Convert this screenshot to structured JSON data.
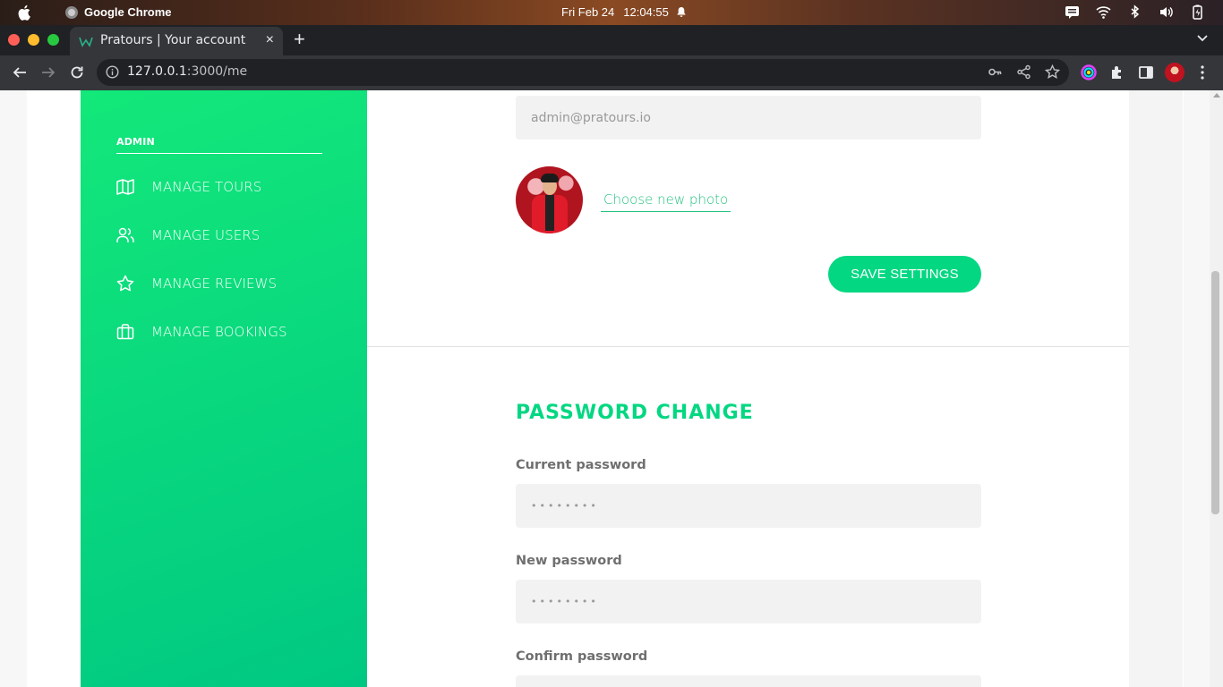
{
  "os": {
    "app_name": "Google Chrome",
    "date": "Fri Feb 24",
    "time": "12:04:55"
  },
  "browser": {
    "tab_title": "Pratours | Your account",
    "tab_close": "×",
    "new_tab": "+",
    "url_host": "127.0.0.1",
    "url_rest": ":3000/me"
  },
  "sidebar": {
    "heading": "ADMIN",
    "items": [
      {
        "label": "MANAGE TOURS",
        "icon": "map-icon"
      },
      {
        "label": "MANAGE USERS",
        "icon": "users-icon"
      },
      {
        "label": "MANAGE REVIEWS",
        "icon": "star-icon"
      },
      {
        "label": "MANAGE BOOKINGS",
        "icon": "briefcase-icon"
      }
    ]
  },
  "settings": {
    "email_value": "admin@pratours.io",
    "choose_photo": "Choose new photo",
    "save_label": "SAVE SETTINGS"
  },
  "password": {
    "title": "PASSWORD CHANGE",
    "current_label": "Current password",
    "current_placeholder": "••••••••",
    "new_label": "New password",
    "new_placeholder": "••••••••",
    "confirm_label": "Confirm password"
  },
  "colors": {
    "accent": "#03d782",
    "sidebar_start": "#13e87a",
    "sidebar_end": "#00c882"
  }
}
